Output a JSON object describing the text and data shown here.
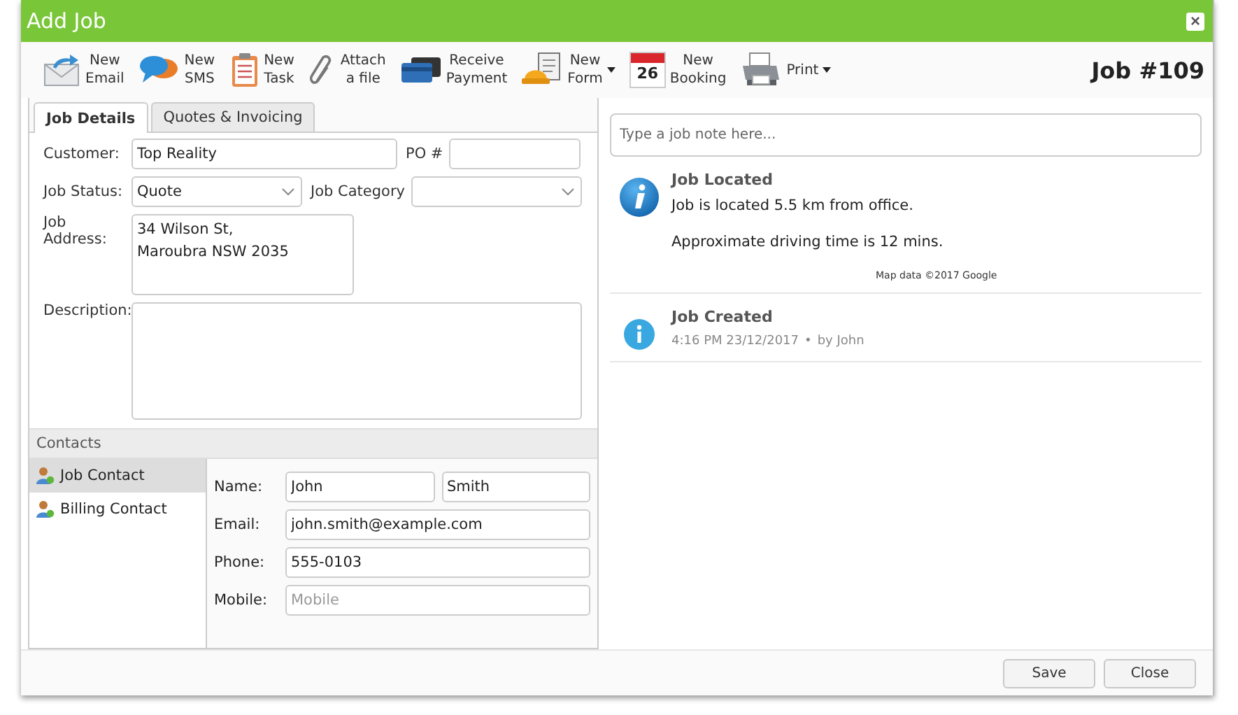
{
  "window": {
    "title": "Add Job",
    "close": "×"
  },
  "toolbar": [
    {
      "kind": "email",
      "lines": [
        "New",
        "Email"
      ],
      "caret": false
    },
    {
      "kind": "sms",
      "lines": [
        "New",
        "SMS"
      ],
      "caret": false
    },
    {
      "kind": "task",
      "lines": [
        "New",
        "Task"
      ],
      "caret": false
    },
    {
      "kind": "attach",
      "lines": [
        "Attach",
        "a file"
      ],
      "caret": false
    },
    {
      "kind": "payment",
      "lines": [
        "Receive",
        "Payment"
      ],
      "caret": false
    },
    {
      "kind": "form",
      "lines": [
        "New",
        "Form"
      ],
      "caret": true
    },
    {
      "kind": "booking",
      "lines": [
        "New",
        "Booking"
      ],
      "caret": false,
      "icon_text": "26"
    },
    {
      "kind": "print",
      "lines": [
        "Print"
      ],
      "caret": true
    }
  ],
  "job_number": "Job #109",
  "tabs": [
    {
      "label": "Job Details",
      "selected": true
    },
    {
      "label": "Quotes & Invoicing",
      "selected": false
    }
  ],
  "form": {
    "customer_label": "Customer:",
    "customer": "Top Reality",
    "po_label": "PO #",
    "status_label": "Job Status:",
    "status": "Quote",
    "category_label": "Job Category",
    "address_label": "Job Address:",
    "address": "34 Wilson St,\nMaroubra NSW 2035",
    "description_label": "Description:"
  },
  "contacts": {
    "title": "Contacts",
    "items": [
      {
        "label": "Job Contact",
        "selected": true
      },
      {
        "label": "Billing Contact",
        "selected": false
      }
    ],
    "fields": [
      {
        "label": "Name:",
        "values": [
          "John",
          "Smith"
        ]
      },
      {
        "label": "Email:",
        "values": [
          "john.smith@example.com"
        ]
      },
      {
        "label": "Phone:",
        "values": [
          "555-0103"
        ]
      },
      {
        "label": "Mobile:",
        "placeholder": "Mobile"
      }
    ]
  },
  "note": {
    "placeholder": "Type a job note here..."
  },
  "events": [
    {
      "kind": "located",
      "title": "Job Located",
      "lines": [
        "Job is located 5.5 km from office.",
        "Approximate driving time is 12 mins."
      ],
      "credit": "Map data ©2017 Google"
    },
    {
      "kind": "created",
      "title": "Job Created",
      "time": "4:16 PM 23/12/2017",
      "sep": "•",
      "author": "by John"
    }
  ],
  "buttons": [
    "Save",
    "Close"
  ]
}
